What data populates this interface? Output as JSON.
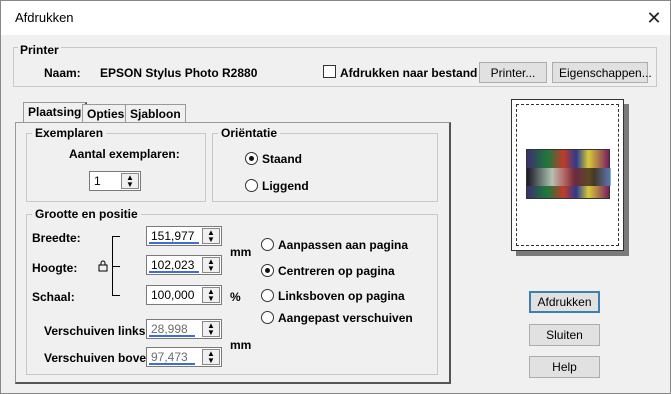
{
  "window": {
    "title": "Afdrukken",
    "close_glyph": "✕"
  },
  "printer": {
    "group_label": "Printer",
    "name_label": "Naam:",
    "name_value": "EPSON Stylus Photo R2880",
    "print_to_file_label": "Afdrukken naar bestand",
    "print_to_file_checked": false,
    "printer_button": "Printer...",
    "properties_button": "Eigenschappen..."
  },
  "tabs": [
    {
      "label": "Plaatsing",
      "active": true
    },
    {
      "label": "Opties",
      "active": false
    },
    {
      "label": "Sjabloon",
      "active": false
    }
  ],
  "copies": {
    "group_label": "Exemplaren",
    "count_label": "Aantal exemplaren:",
    "count_value": "1"
  },
  "orientation": {
    "group_label": "Oriëntatie",
    "options": [
      {
        "label": "Staand",
        "selected": true
      },
      {
        "label": "Liggend",
        "selected": false
      }
    ]
  },
  "size_position": {
    "group_label": "Grootte en positie",
    "width_label": "Breedte:",
    "width_value": "151,977",
    "height_label": "Hoogte:",
    "height_value": "102,023",
    "scale_label": "Schaal:",
    "scale_value": "100,000",
    "unit_mm": "mm",
    "unit_pct": "%",
    "shift_left_label": "Verschuiven links:",
    "shift_left_value": "28,998",
    "shift_top_label": "Verschuiven boven:",
    "shift_top_value": "97,473",
    "unit_mm2": "mm",
    "placement_options": [
      {
        "label": "Aanpassen aan pagina",
        "selected": false
      },
      {
        "label": "Centreren op pagina",
        "selected": true
      },
      {
        "label": "Linksboven op pagina",
        "selected": false
      },
      {
        "label": "Aangepast verschuiven",
        "selected": false
      }
    ]
  },
  "actions": {
    "print_button": "Afdrukken",
    "close_button": "Sluiten",
    "help_button": "Help"
  },
  "icons": {
    "close": "close-icon",
    "lock": "lock-icon",
    "spin": "spin-arrows-icon"
  }
}
